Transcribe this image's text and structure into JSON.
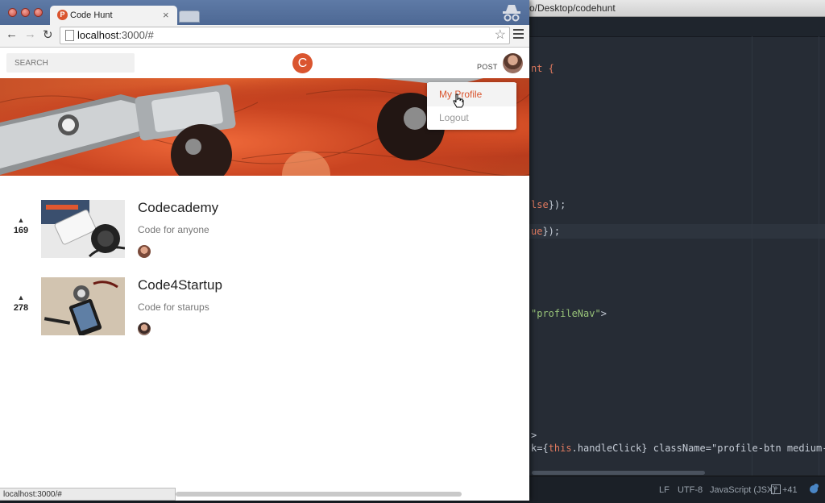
{
  "browser": {
    "tab_title": "Code Hunt",
    "tab_favicon": "P",
    "tab_close": "×",
    "url_host": "localhost",
    "url_rest": ":3000/#",
    "status_url": "localhost:3000/#",
    "icons": [
      "back-arrow-icon",
      "forward-arrow-icon",
      "reload-icon",
      "page-icon",
      "star-icon",
      "menu-icon",
      "incognito-icon"
    ]
  },
  "app": {
    "search_placeholder": "SEARCH",
    "logo_letter": "C",
    "post_link": "POST",
    "dropdown": {
      "my_profile": "My Profile",
      "logout": "Logout"
    },
    "posts": [
      {
        "votes": "169",
        "title": "Codecademy",
        "tagline": "Code for anyone"
      },
      {
        "votes": "278",
        "title": "Code4Startup",
        "tagline": "Code for starups"
      }
    ],
    "vote_arrow": "▲",
    "accent": "#da552f"
  },
  "editor": {
    "title": "o/Desktop/codehunt",
    "lines": [
      {
        "pre": "nt {",
        "kw": "",
        "str": "",
        "post": ""
      },
      {
        "pre": "",
        "kw": "lse",
        "str": "",
        "post": "});"
      },
      {
        "pre": "",
        "kw": "ue",
        "str": "",
        "post": "});"
      },
      {
        "pre": "",
        "kw": "",
        "str": "\"profileNav\"",
        "post": ">"
      },
      {
        "pre": ">",
        "kw": "",
        "str": "",
        "post": ""
      },
      {
        "pre": "k={",
        "kw": "this",
        "str": "",
        "post": ".handleClick} className=\"profile-btn medium-av"
      }
    ],
    "status": {
      "eol": "LF",
      "encoding": "UTF-8",
      "grammar": "JavaScript (JSX)",
      "git": "+41"
    }
  }
}
